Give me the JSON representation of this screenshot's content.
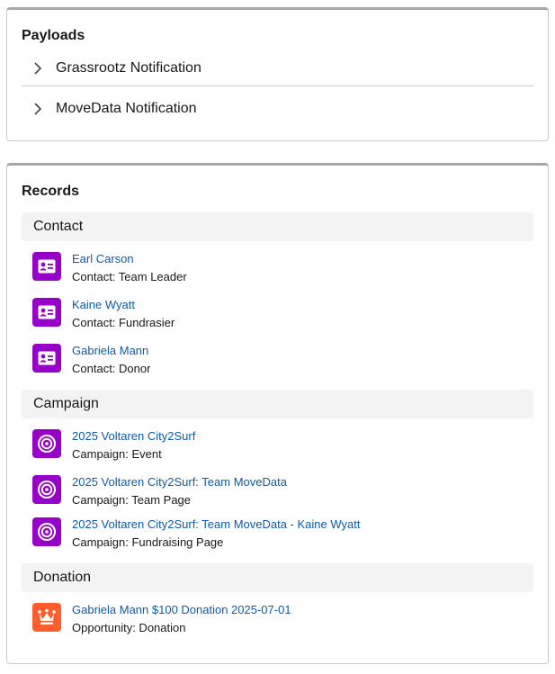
{
  "payloads": {
    "title": "Payloads",
    "items": [
      {
        "label": "Grassrootz Notification"
      },
      {
        "label": "MoveData Notification"
      }
    ]
  },
  "records": {
    "title": "Records",
    "sections": [
      {
        "label": "Contact",
        "icon": "contact-card-icon",
        "color": "#9602c7",
        "items": [
          {
            "name": "Earl Carson",
            "type": "Contact: Team Leader"
          },
          {
            "name": "Kaine Wyatt",
            "type": "Contact: Fundrasier"
          },
          {
            "name": "Gabriela Mann",
            "type": "Contact: Donor"
          }
        ]
      },
      {
        "label": "Campaign",
        "icon": "target-icon",
        "color": "#9602c7",
        "items": [
          {
            "name": "2025 Voltaren City2Surf",
            "type": "Campaign: Event"
          },
          {
            "name": "2025 Voltaren City2Surf: Team MoveData",
            "type": "Campaign: Team Page"
          },
          {
            "name": "2025 Voltaren City2Surf: Team MoveData - Kaine Wyatt",
            "type": "Campaign: Fundraising Page"
          }
        ]
      },
      {
        "label": "Donation",
        "icon": "crown-icon",
        "color": "#ff5d2d",
        "items": [
          {
            "name": "Gabriela Mann $100 Donation 2025-07-01",
            "type": "Opportunity: Donation"
          }
        ]
      }
    ]
  }
}
